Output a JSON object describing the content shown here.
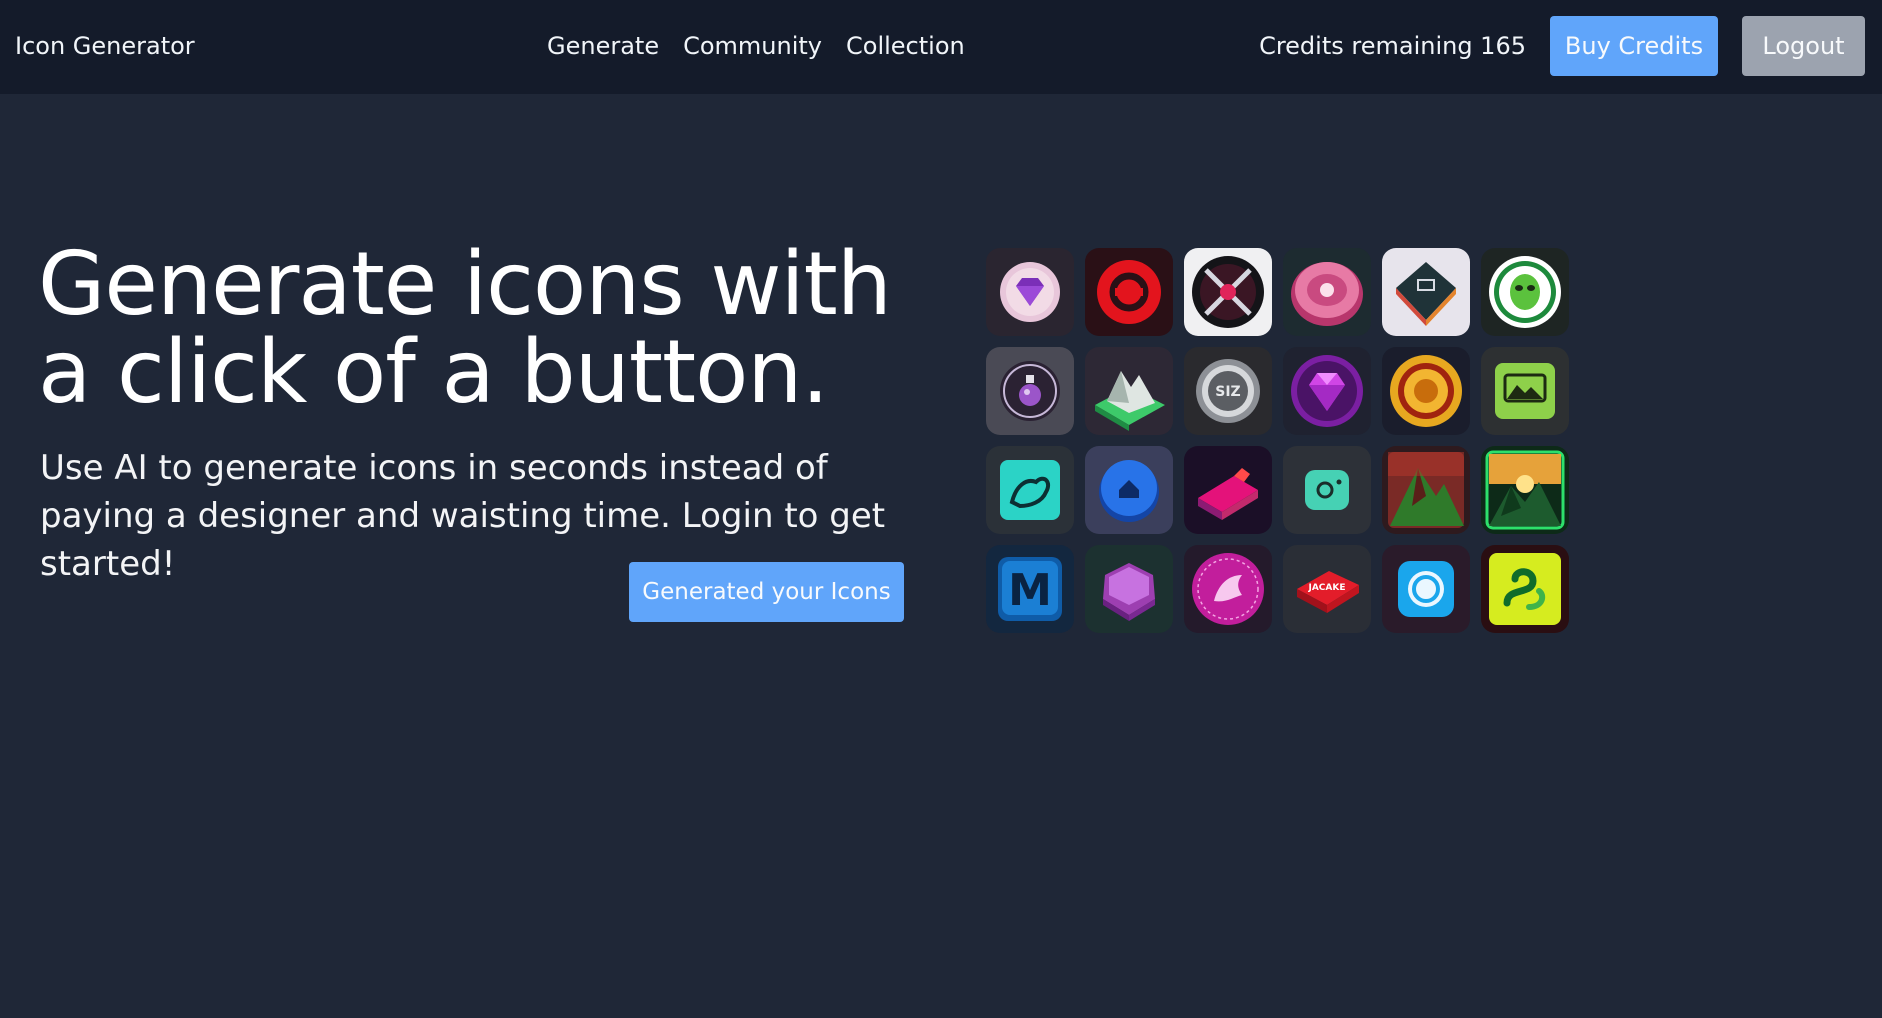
{
  "app": {
    "title": "Icon Generator"
  },
  "nav": {
    "links": [
      {
        "label": "Generate"
      },
      {
        "label": "Community"
      },
      {
        "label": "Collection"
      }
    ],
    "credits_label": "Credits remaining 165",
    "buy_label": "Buy Credits",
    "logout_label": "Logout"
  },
  "hero": {
    "title": "Generate icons with a click of a button.",
    "subtitle": "Use AI to generate icons in seconds instead of paying a designer and waisting time. Login to get started!",
    "cta_label": "Generated your Icons"
  },
  "colors": {
    "page_bg": "#1f2737",
    "nav_bg": "#141b2a",
    "primary": "#60a5fa",
    "secondary": "#9ca3af"
  },
  "gallery": {
    "icons": [
      {
        "name": "purple-gem-coin-icon"
      },
      {
        "name": "red-ring-icon"
      },
      {
        "name": "crossed-swords-icon"
      },
      {
        "name": "pink-badge-icon"
      },
      {
        "name": "dark-cube-icon"
      },
      {
        "name": "green-alien-icon"
      },
      {
        "name": "potion-bottle-icon"
      },
      {
        "name": "mountain-island-icon"
      },
      {
        "name": "silver-coin-icon",
        "text": "SIZ"
      },
      {
        "name": "purple-diamond-icon"
      },
      {
        "name": "gold-medallion-icon"
      },
      {
        "name": "green-landscape-icon"
      },
      {
        "name": "flexing-arm-icon"
      },
      {
        "name": "blue-house-button-icon"
      },
      {
        "name": "neon-cube-icon"
      },
      {
        "name": "teal-camera-icon"
      },
      {
        "name": "volcano-mountain-icon"
      },
      {
        "name": "green-mountain-sunset-icon"
      },
      {
        "name": "letter-m-icon",
        "text": "M"
      },
      {
        "name": "purple-hexagon-icon"
      },
      {
        "name": "magenta-dragon-icon"
      },
      {
        "name": "red-tag-icon",
        "text": "JACAKE"
      },
      {
        "name": "blue-shutter-icon"
      },
      {
        "name": "green-snake-icon"
      }
    ]
  }
}
